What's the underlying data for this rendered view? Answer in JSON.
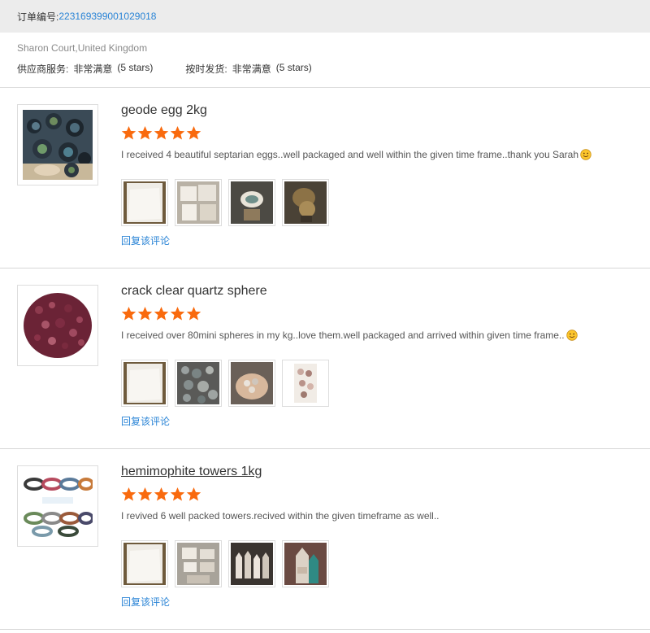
{
  "order": {
    "label": "订单编号:",
    "number": "223169399001029018"
  },
  "buyer": {
    "address": "Sharon Court,United Kingdom"
  },
  "seller_ratings": {
    "service_label": "供应商服务:",
    "service_value": "非常满意",
    "service_stars": "(5 stars)",
    "shipping_label": "按时发货:",
    "shipping_value": "非常满意",
    "shipping_stars": "(5 stars)"
  },
  "reviews": [
    {
      "title": "geode egg 2kg",
      "rating": 5,
      "comment": "I received 4 beautiful septarian eggs..well packaged and well within the given time frame..thank you Sarah",
      "reply_label": "回复该评论",
      "photo_count": 4,
      "thumb_icon": "geode-photo"
    },
    {
      "title": "crack clear quartz sphere",
      "rating": 5,
      "comment": "I received over 80mini spheres in my kg..love them.well packaged and arrived within given time frame..",
      "reply_label": "回复该评论",
      "photo_count": 4,
      "thumb_icon": "quartz-photo"
    },
    {
      "title": "hemimophite towers 1kg",
      "rating": 5,
      "comment": "I revived 6 well packed towers.recived within the given timeframe as well..",
      "reply_label": "回复该评论",
      "photo_count": 4,
      "thumb_icon": "bracelet-photo"
    }
  ],
  "colors": {
    "link": "#2a84d6",
    "star": "#f96a0e",
    "header_bg": "#ececec"
  }
}
